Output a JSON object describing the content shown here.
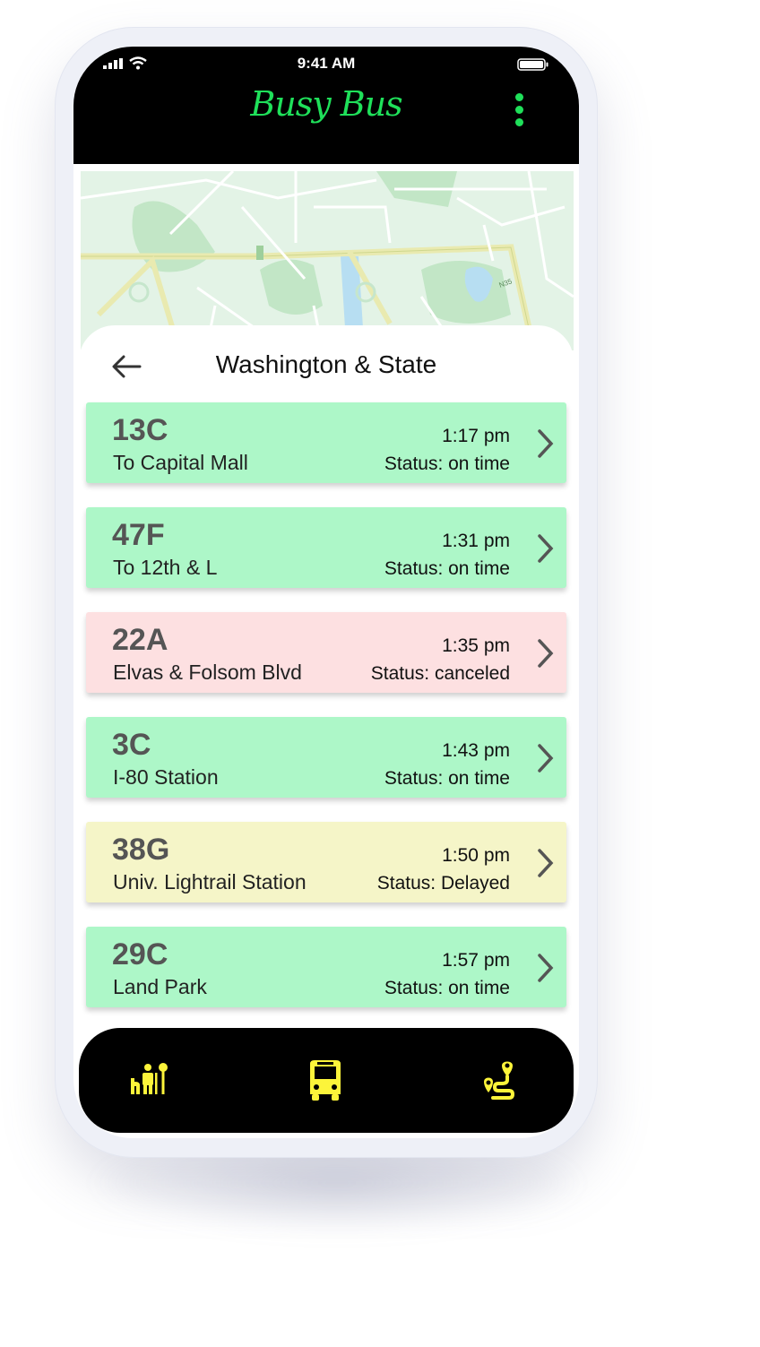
{
  "status_bar": {
    "time": "9:41 AM"
  },
  "app": {
    "title": "Busy Bus"
  },
  "stop": {
    "name": "Washington & State"
  },
  "map": {
    "labels": [
      "N35",
      "N35"
    ]
  },
  "buses": [
    {
      "route": "13C",
      "destination": "To Capital Mall",
      "time": "1:17 pm",
      "status": "Status: on time",
      "color": "#adf7c8"
    },
    {
      "route": "47F",
      "destination": "To 12th & L",
      "time": "1:31 pm",
      "status": "Status: on time",
      "color": "#adf7c8"
    },
    {
      "route": "22A",
      "destination": "Elvas & Folsom Blvd",
      "time": "1:35 pm",
      "status": "Status: canceled",
      "color": "#fde0e1"
    },
    {
      "route": "3C",
      "destination": "I-80 Station",
      "time": "1:43 pm",
      "status": "Status: on time",
      "color": "#adf7c8"
    },
    {
      "route": "38G",
      "destination": "Univ. Lightrail Station",
      "time": "1:50 pm",
      "status": "Status: Delayed",
      "color": "#f5f5c8"
    },
    {
      "route": "29C",
      "destination": "Land Park",
      "time": "1:57 pm",
      "status": "Status: on time",
      "color": "#adf7c8"
    }
  ],
  "nav": {
    "items": [
      {
        "icon": "bus-stop-icon"
      },
      {
        "icon": "bus-icon"
      },
      {
        "icon": "route-icon"
      }
    ],
    "icon_color": "#fcf43a"
  },
  "colors": {
    "accent": "#1fe05a",
    "header_bg": "#000000"
  }
}
